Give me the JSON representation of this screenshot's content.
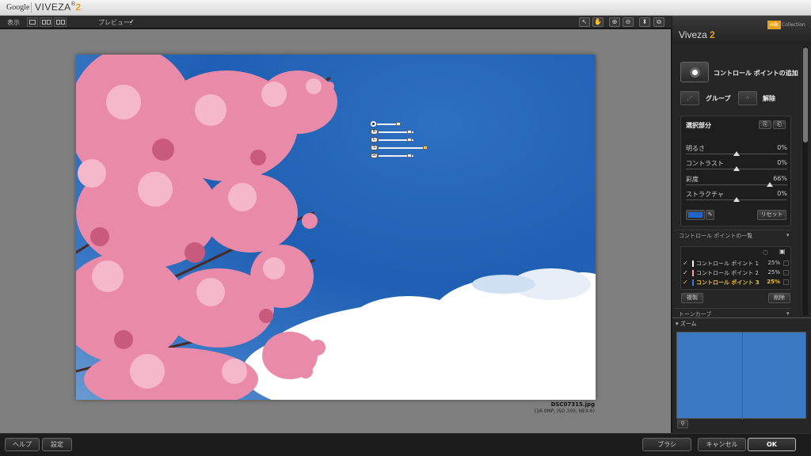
{
  "titlebar": {
    "google": "Google",
    "app_name": "VIVEZA",
    "reg": "®",
    "version": "2"
  },
  "toolbar": {
    "view_label": "表示",
    "preview_label": "プレビュー:",
    "preview_check": "✓",
    "icons": [
      "arrow-select-icon",
      "hand-icon",
      "zoom-in-icon",
      "zoom-out-icon",
      "eyedropper-icon",
      "compare-icon"
    ]
  },
  "photo": {
    "filename": "DSC07315.jpg",
    "meta": "(16.0MP, ISO 100, NEX-6)"
  },
  "control_point": {
    "tags": [
      "B",
      "C",
      "S",
      "St"
    ]
  },
  "sidebar": {
    "title": "Viveza",
    "title_version": "2",
    "nik_logo": "nik",
    "nik_collection": "Collection",
    "add_control_point": "コントロール ポイントの追加",
    "group": "グループ",
    "ungroup": "解除",
    "selection": {
      "title": "選択部分",
      "sliders": [
        {
          "name": "明るさ",
          "value": "0%",
          "pos": 0.5
        },
        {
          "name": "コントラスト",
          "value": "0%",
          "pos": 0.5
        },
        {
          "name": "彩度",
          "value": "66%",
          "pos": 0.83
        },
        {
          "name": "ストラクチャ",
          "value": "0%",
          "pos": 0.5
        }
      ],
      "color_hex": "#1f66c8",
      "reset": "リセット"
    },
    "cp_list_label": "コントロール ポイントの一覧",
    "cp_items": [
      {
        "name": "コントロール ポイント 1",
        "pct": "25%",
        "check": "✓",
        "color": "#ffffff"
      },
      {
        "name": "コントロール ポイント 2",
        "pct": "25%",
        "check": "✓",
        "color": "#ff9fb0"
      },
      {
        "name": "コントロール ポイント 3",
        "pct": "25%",
        "check": "✓",
        "color": "#2f7be0"
      }
    ],
    "duplicate": "複製",
    "delete": "削除",
    "tone_curve": "トーンカーブ",
    "zoom_label": "▾ ズーム"
  },
  "bottom": {
    "help": "ヘルプ",
    "settings": "設定",
    "brush": "ブラシ",
    "cancel": "キャンセル",
    "ok": "OK"
  }
}
